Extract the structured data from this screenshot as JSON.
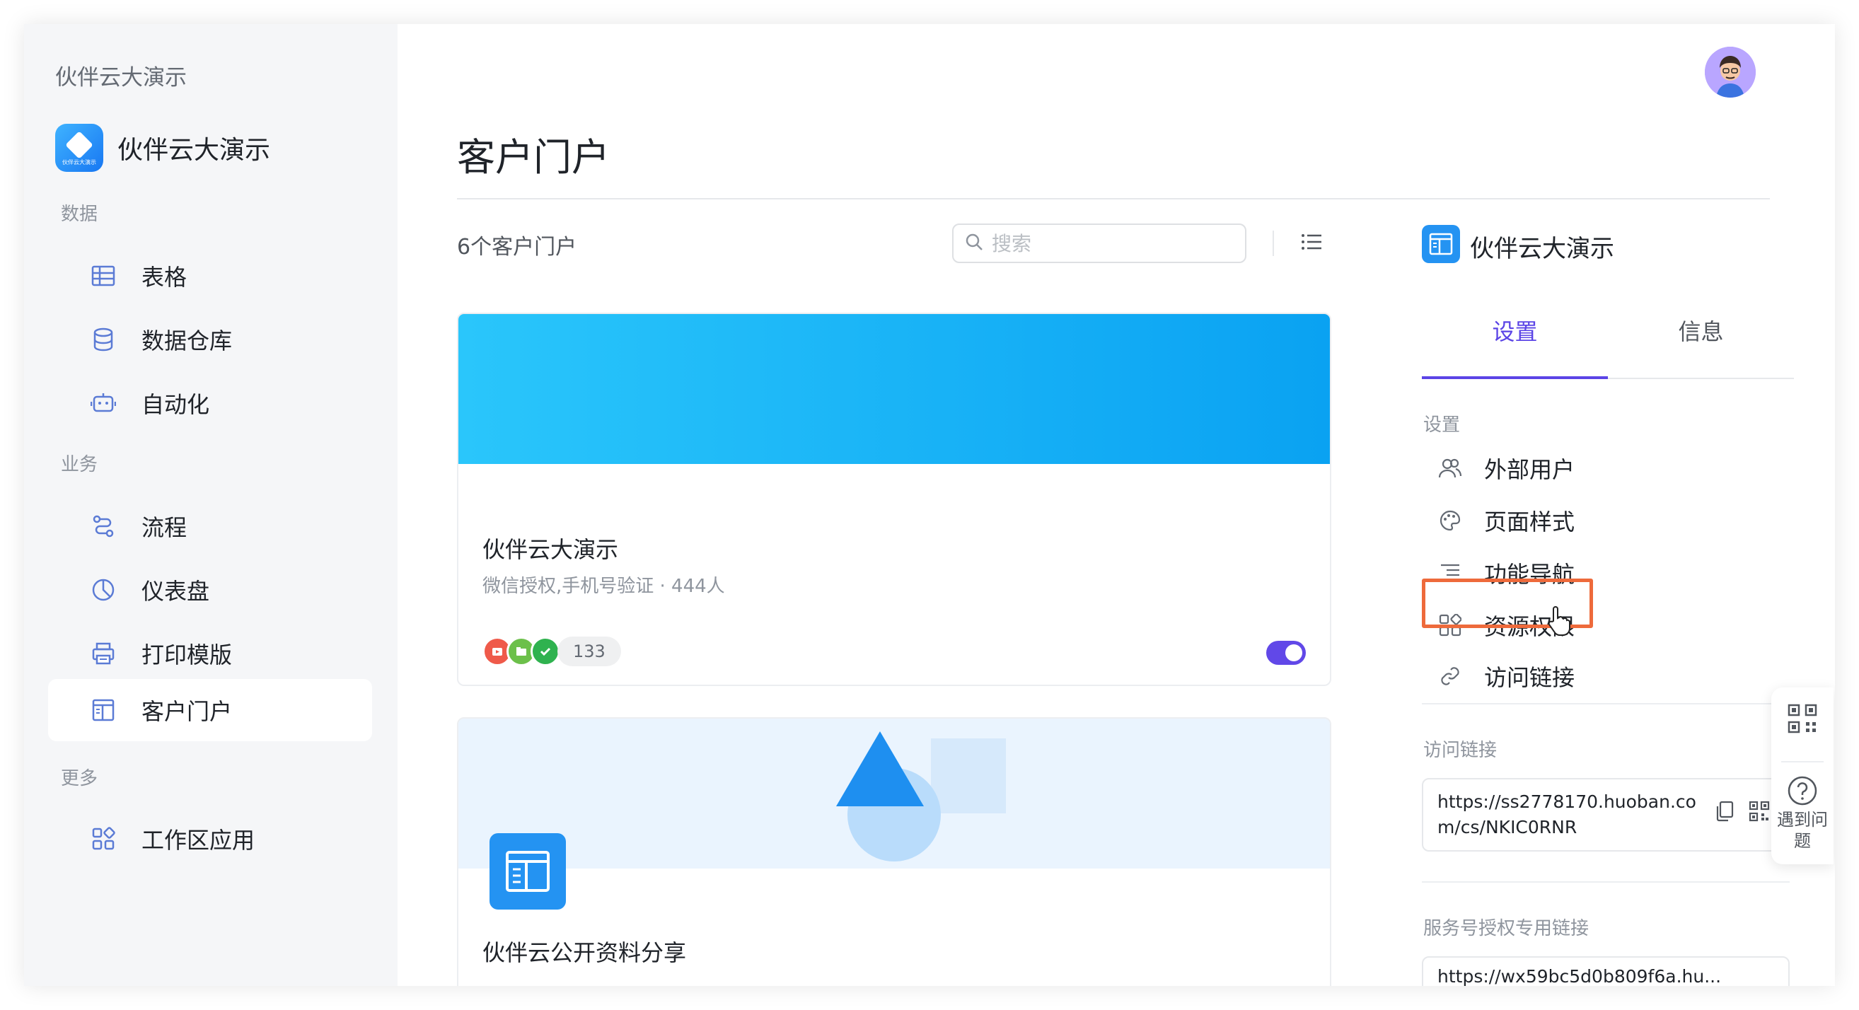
{
  "sidebar": {
    "workspace_title": "伙伴云大演示",
    "app_name": "伙伴云大演示",
    "app_logo_text": "伙伴云大演示",
    "sections": {
      "data": "数据",
      "business": "业务",
      "more": "更多"
    },
    "items": [
      {
        "label": "表格",
        "icon": "table-icon"
      },
      {
        "label": "数据仓库",
        "icon": "database-icon"
      },
      {
        "label": "自动化",
        "icon": "robot-icon"
      },
      {
        "label": "流程",
        "icon": "workflow-icon"
      },
      {
        "label": "仪表盘",
        "icon": "dashboard-icon"
      },
      {
        "label": "打印模版",
        "icon": "printer-icon"
      },
      {
        "label": "客户门户",
        "icon": "portal-icon",
        "active": true
      },
      {
        "label": "工作区应用",
        "icon": "apps-icon"
      }
    ]
  },
  "main": {
    "title": "客户门户",
    "count_text": "6个客户门户",
    "search_placeholder": "搜索",
    "cards": [
      {
        "title": "伙伴云大演示",
        "subtitle": "微信授权,手机号验证 · 444人",
        "member_count": "133",
        "enabled": true
      },
      {
        "title": "伙伴云公开资料分享"
      }
    ]
  },
  "panel": {
    "app_name": "伙伴云大演示",
    "tabs": [
      "设置",
      "信息"
    ],
    "settings_section": "设置",
    "settings_items": [
      {
        "label": "外部用户",
        "icon": "users-icon"
      },
      {
        "label": "页面样式",
        "icon": "palette-icon"
      },
      {
        "label": "功能导航",
        "icon": "navigation-icon"
      },
      {
        "label": "资源权限",
        "icon": "permission-icon",
        "highlighted": true
      },
      {
        "label": "访问链接",
        "icon": "link-icon"
      }
    ],
    "access_link_section": "访问链接",
    "access_link": "https://ss2778170.huoban.com/cs/NKIC0RNR",
    "service_link_section": "服务号授权专用链接",
    "service_link": "https://wx59bc5d0b809f6a.hu..."
  },
  "float_help": {
    "label": "遇到问题"
  },
  "colors": {
    "accent": "#5b44e6",
    "highlight": "#ee6a3b",
    "brand_blue": "#2493f2"
  }
}
